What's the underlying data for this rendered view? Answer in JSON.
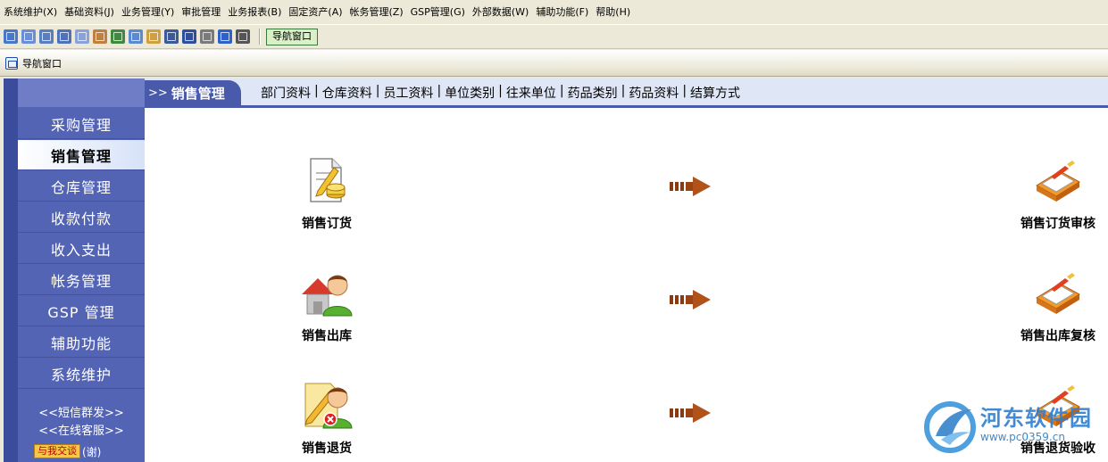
{
  "menu": [
    "系统维护(X)",
    "基础资料(J)",
    "业务管理(Y)",
    "审批管理",
    "业务报表(B)",
    "固定资产(A)",
    "帐务管理(Z)",
    "GSP管理(G)",
    "外部数据(W)",
    "辅助功能(F)",
    "帮助(H)"
  ],
  "toolbar": {
    "icons": [
      {
        "name": "table-icon",
        "color": "#4a78c8"
      },
      {
        "name": "form-icon",
        "color": "#6a8ed8"
      },
      {
        "name": "copy-window-icon",
        "color": "#5a7fc0"
      },
      {
        "name": "window-list-icon",
        "color": "#4f72b8"
      },
      {
        "name": "report-icon",
        "color": "#8aa2d8"
      },
      {
        "name": "tools-icon",
        "color": "#c08040"
      },
      {
        "name": "users-icon",
        "color": "#3f8a3f"
      },
      {
        "name": "export-icon",
        "color": "#5a8ad0"
      },
      {
        "name": "import-icon",
        "color": "#d0a040"
      },
      {
        "name": "monitor-icon",
        "color": "#3c5a98"
      },
      {
        "name": "save-icon",
        "color": "#2e4f9e"
      },
      {
        "name": "print-icon",
        "color": "#7a7a7a"
      },
      {
        "name": "help-icon",
        "color": "#2f62c8"
      },
      {
        "name": "exit-icon",
        "color": "#555555"
      }
    ],
    "nav_button": "导航窗口"
  },
  "nav_window_title": "导航窗口",
  "sidebar": {
    "items": [
      "采购管理",
      "销售管理",
      "仓库管理",
      "收款付款",
      "收入支出",
      "帐务管理",
      "GSP 管理",
      "辅助功能",
      "系统维护"
    ],
    "active_index": 1,
    "links": [
      "<<短信群发>>",
      "<<在线客服>>"
    ],
    "qq_label": "与我交谈",
    "thanks": "(谢)"
  },
  "content": {
    "active_tab": "销售管理",
    "active_tab_prefix": ">>",
    "quick_links": [
      "部门资料",
      "仓库资料",
      "员工资料",
      "单位类别",
      "往来单位",
      "药品类别",
      "药品资料",
      "结算方式"
    ],
    "functions": [
      {
        "label": "销售订货",
        "icon": "sales-order-icon"
      },
      {
        "label": "销售订货审核",
        "icon": "approve-icon"
      },
      {
        "label": "销售出库",
        "icon": "sales-outbound-icon"
      },
      {
        "label": "销售出库复核",
        "icon": "recheck-icon"
      },
      {
        "label": "销售退货",
        "icon": "sales-return-icon"
      },
      {
        "label": "销售退货验收",
        "icon": "return-inspect-icon"
      }
    ]
  },
  "watermark": {
    "name": "河东软件园",
    "url": "www.pc0359.cn"
  }
}
